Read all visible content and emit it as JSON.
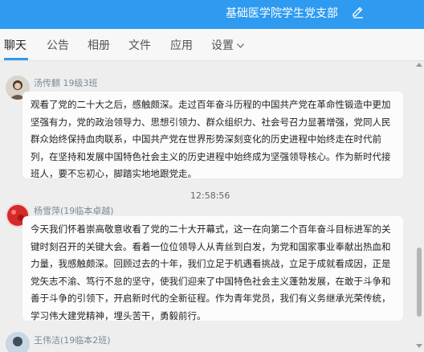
{
  "header": {
    "title": "基础医学院学生党支部",
    "edit_icon": "pencil-icon",
    "background_color": "#2e9bf0"
  },
  "tabs": [
    {
      "label": "聊天",
      "active": true
    },
    {
      "label": "公告"
    },
    {
      "label": "相册"
    },
    {
      "label": "文件"
    },
    {
      "label": "应用"
    },
    {
      "label": "设置"
    }
  ],
  "messages": [
    {
      "sender": "汤传麒 19级3班",
      "text": "观看了党的二十大之后，感触颇深。走过百年奋斗历程的中国共产党在革命性锻造中更加坚强有力，党的政治领导力、思想引领力、群众组织力、社会号召力显著增强，党同人民群众始终保持血肉联系，中国共产党在世界形势深刻变化的历史进程中始终走在时代前列，在坚持和发展中国特色社会主义的历史进程中始终成为坚强领导核心。作为新时代接班人，要不忘初心，脚踏实地地跟党走。"
    },
    {
      "time": "12:58:56"
    },
    {
      "sender": "杨雪萍(19临本卓越)",
      "text": "今天我们怀着崇高敬意收看了党的二十大开幕式，这一在向第二个百年奋斗目标进军的关键时刻召开的关键大会。看着一位位领导人从青丝到白发，为党和国家事业奉献出热血和力量，我感触颇深。回顾过去的十年，我们立足于机遇看挑战，立足于成就看成因，正是党矢志不渝、笃行不怠的坚守，使我们迎来了中国特色社会主义蓬勃发展，在敢于斗争和善于斗争的引领下，开启新时代的全新征程。作为青年党员，我们有义务继承光荣传统，学习伟大建党精神，埋头苦干，勇毅前行。"
    },
    {
      "sender": "王伟洁(19临本2班)"
    }
  ]
}
